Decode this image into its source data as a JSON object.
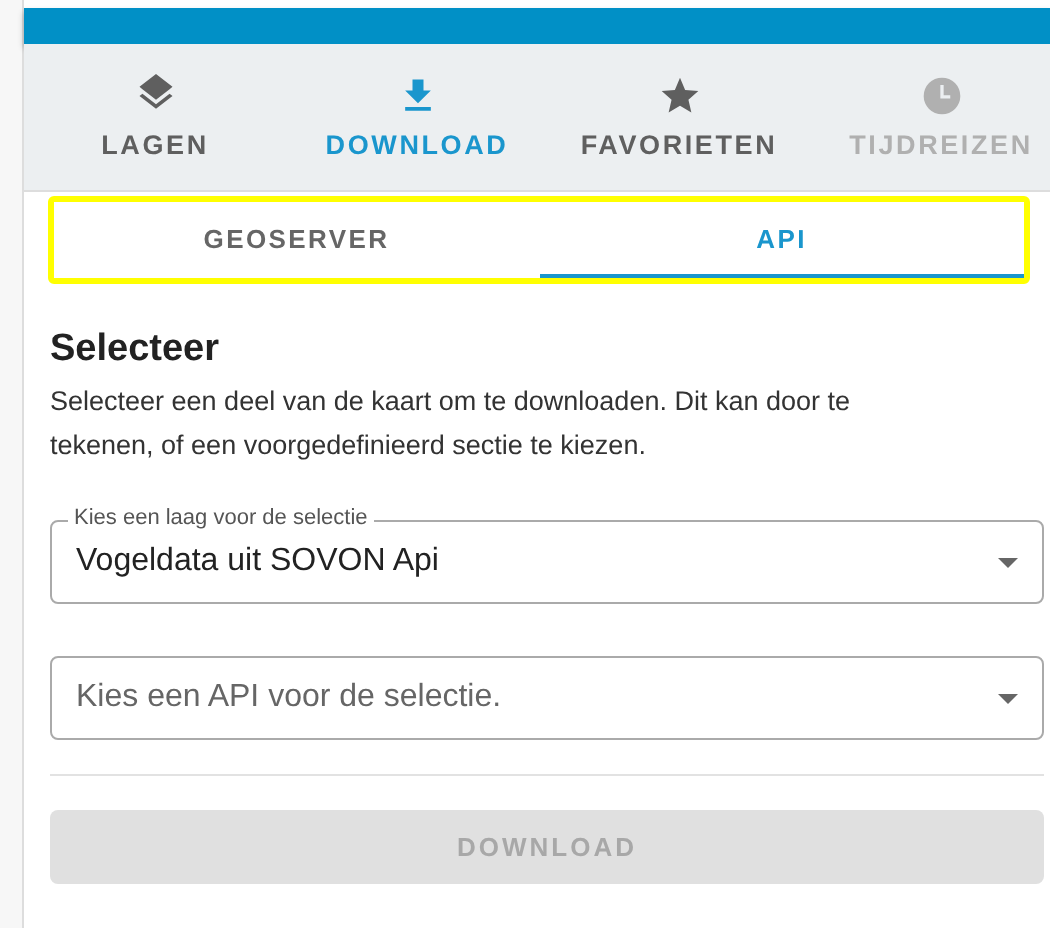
{
  "nav_tabs": [
    {
      "label": "LAGEN",
      "kind": "layers",
      "selected": false,
      "disabled": false
    },
    {
      "label": "DOWNLOAD",
      "kind": "download",
      "selected": true,
      "disabled": false
    },
    {
      "label": "FAVORIETEN",
      "kind": "star",
      "selected": false,
      "disabled": false
    },
    {
      "label": "TIJDREIZEN",
      "kind": "clock",
      "selected": false,
      "disabled": true
    }
  ],
  "sub_tabs": [
    {
      "label": "GEOSERVER",
      "selected": false
    },
    {
      "label": "API",
      "selected": true
    }
  ],
  "heading": "Selecteer",
  "description": "Selecteer een deel van de kaart om te downloaden. Dit kan door te tekenen, of een voorgedefinieerd sectie te kiezen.",
  "selects": [
    {
      "label": "Kies een laag voor de selectie",
      "value": "Vogeldata uit SOVON Api"
    },
    {
      "placeholder": "Kies een API voor de selectie."
    }
  ],
  "download_button": {
    "label": "DOWNLOAD",
    "disabled": true
  }
}
